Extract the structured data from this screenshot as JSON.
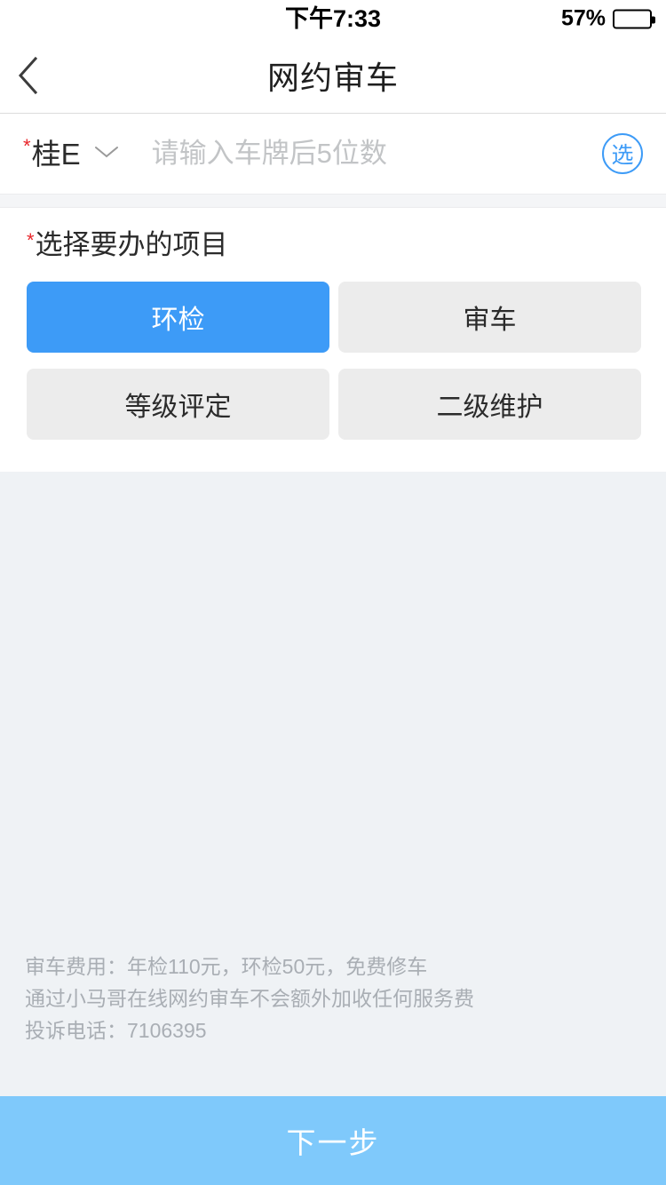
{
  "status_bar": {
    "time": "下午7:33",
    "battery_percent_label": "57%",
    "battery_level": 57
  },
  "header": {
    "title": "网约审车",
    "back_icon": "chevron-left-icon"
  },
  "plate_input": {
    "required_marker": "*",
    "province_prefix": "桂E",
    "dropdown_icon": "chevron-down-icon",
    "placeholder": "请输入车牌后5位数",
    "value": "",
    "pick_button_label": "选"
  },
  "project_section": {
    "required_marker": "*",
    "label": "选择要办的项目",
    "options": [
      {
        "label": "环检",
        "selected": true
      },
      {
        "label": "审车",
        "selected": false
      },
      {
        "label": "等级评定",
        "selected": false
      },
      {
        "label": "二级维护",
        "selected": false
      }
    ]
  },
  "footer_notes": [
    "审车费用：年检110元，环检50元，免费修车",
    "通过小马哥在线网约审车不会额外加收任何服务费",
    "投诉电话：7106395"
  ],
  "bottom_action": {
    "label": "下一步"
  },
  "colors": {
    "accent_blue": "#3d9bf7",
    "bottom_button_blue": "#7fc9fb",
    "page_background": "#eff2f5",
    "option_unselected": "#ececec",
    "required_red": "#e8252a",
    "note_gray": "#a9aeb4"
  }
}
